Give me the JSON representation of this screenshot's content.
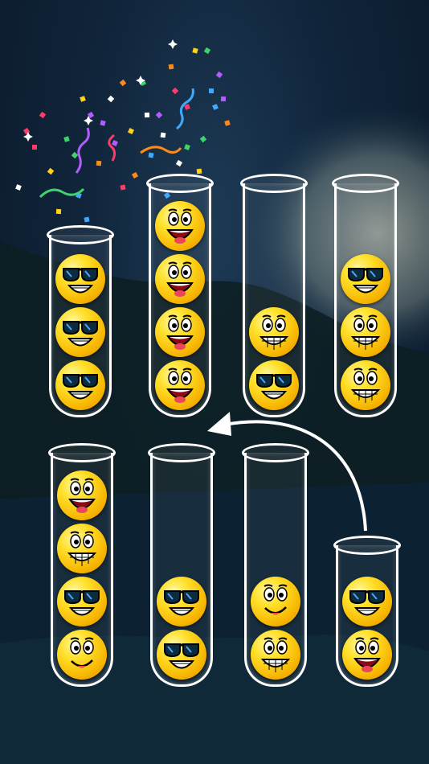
{
  "game": {
    "tubes": [
      {
        "id": "tube-1",
        "row": "top",
        "balls": [
          "sunglasses",
          "sunglasses",
          "sunglasses"
        ],
        "completed": true
      },
      {
        "id": "tube-2",
        "row": "top",
        "balls": [
          "laughing",
          "laughing",
          "laughing",
          "laughing"
        ]
      },
      {
        "id": "tube-3",
        "row": "top",
        "balls": [
          "grinning",
          "sunglasses"
        ]
      },
      {
        "id": "tube-4",
        "row": "top",
        "balls": [
          "sunglasses",
          "grinning",
          "grinning"
        ]
      },
      {
        "id": "tube-5",
        "row": "bottom",
        "balls": [
          "laughing",
          "grinning",
          "sunglasses",
          "smiling"
        ]
      },
      {
        "id": "tube-6",
        "row": "bottom",
        "balls": [
          "sunglasses",
          "sunglasses"
        ]
      },
      {
        "id": "tube-7",
        "row": "bottom",
        "balls": [
          "smiling",
          "grinning"
        ]
      },
      {
        "id": "tube-8",
        "row": "bottom",
        "balls": [
          "sunglasses",
          "laughing"
        ]
      }
    ],
    "hint_arrow": {
      "from": "tube-8",
      "to": "tube-2"
    },
    "colors": {
      "tube": "#ffffff",
      "ball": "#ffd21a",
      "background": "#10243a",
      "moon": "#f4f2d8"
    },
    "icons": [
      "sunglasses-emoji-icon",
      "laughing-emoji-icon",
      "grinning-emoji-icon",
      "smiling-emoji-icon",
      "confetti-icon"
    ]
  }
}
